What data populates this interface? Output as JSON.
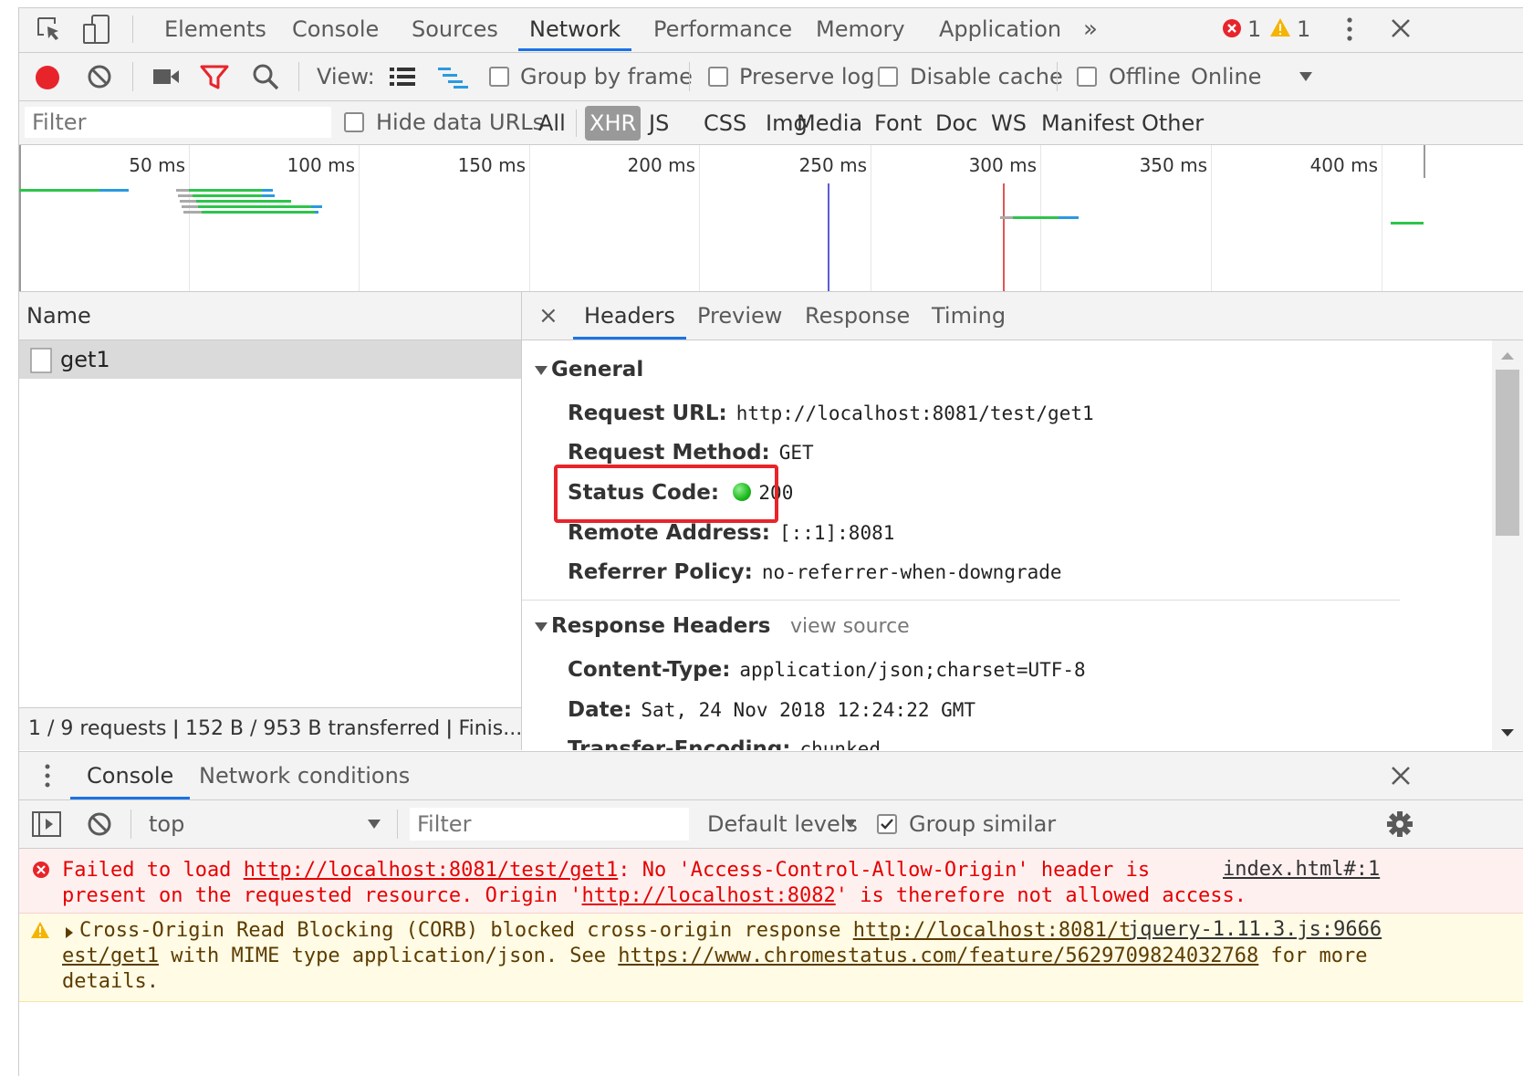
{
  "main_tabs": [
    "Elements",
    "Console",
    "Sources",
    "Network",
    "Performance",
    "Memory",
    "Application"
  ],
  "more_tabs_glyph": "»",
  "error_count": "1",
  "warning_count": "1",
  "toolbar": {
    "view_label": "View:",
    "group_by_frame": "Group by frame",
    "preserve_log": "Preserve log",
    "disable_cache": "Disable cache",
    "offline": "Offline",
    "throttling": "Online"
  },
  "filter": {
    "placeholder": "Filter",
    "hide_data_urls": "Hide data URLs",
    "types": [
      "All",
      "XHR",
      "JS",
      "CSS",
      "Img",
      "Media",
      "Font",
      "Doc",
      "WS",
      "Manifest",
      "Other"
    ],
    "active_type": "XHR"
  },
  "overview": {
    "ticks": [
      "50 ms",
      "100 ms",
      "150 ms",
      "200 ms",
      "250 ms",
      "300 ms",
      "350 ms",
      "400 ms"
    ]
  },
  "requests": {
    "column_name": "Name",
    "rows": [
      "get1"
    ],
    "summary": "1 / 9 requests  ǀ  152 B / 953 B transferred  ǀ  Finis..."
  },
  "detail": {
    "close_glyph": "×",
    "tabs": [
      "Headers",
      "Preview",
      "Response",
      "Timing"
    ],
    "general_title": "General",
    "general": [
      {
        "key": "Request URL:",
        "value": "http://localhost:8081/test/get1"
      },
      {
        "key": "Request Method:",
        "value": "GET"
      },
      {
        "key": "Status Code:",
        "value": "200"
      },
      {
        "key": "Remote Address:",
        "value": "[::1]:8081"
      },
      {
        "key": "Referrer Policy:",
        "value": "no-referrer-when-downgrade"
      }
    ],
    "response_headers_title": "Response Headers",
    "view_source": "view source",
    "response_headers": [
      {
        "key": "Content-Type:",
        "value": "application/json;charset=UTF-8"
      },
      {
        "key": "Date:",
        "value": "Sat, 24 Nov 2018 12:24:22 GMT"
      },
      {
        "key": "Transfer-Encoding:",
        "value": "chunked"
      }
    ],
    "status_color": "#1db91d"
  },
  "drawer": {
    "tabs": [
      "Console",
      "Network conditions"
    ],
    "context": "top",
    "filter_placeholder": "Filter",
    "levels": "Default levels",
    "group_similar": "Group similar"
  },
  "messages": {
    "error": {
      "l1_a": "Failed to load ",
      "l1_link": "http://localhost:8081/test/get1",
      "l1_b": ": No 'Access-Control-Allow-Origin' header is",
      "l2_a": "present on the requested resource. Origin '",
      "l2_link": "http://localhost:8082",
      "l2_b": "' is therefore not allowed access.",
      "source": "index.html#:1"
    },
    "warning": {
      "l1_a": "Cross-Origin Read Blocking (CORB) blocked cross-origin response ",
      "l1_link": "http://localhost:8081/t",
      "l2_link": "est/get1",
      "l2_a": " with MIME type application/json. See ",
      "l2_link2": "https://www.chromestatus.com/feature/5629709824032768",
      "l2_b": " for more",
      "l3": "details.",
      "source": "jquery-1.11.3.js:9666"
    }
  },
  "colors": {
    "accent": "#1a73e8",
    "record_red": "#e8242b",
    "error_text": "#e60000",
    "warning_icon": "#f4b400",
    "waterfall_green": "#2ec44b",
    "waterfall_blue": "#2a9ae0"
  }
}
